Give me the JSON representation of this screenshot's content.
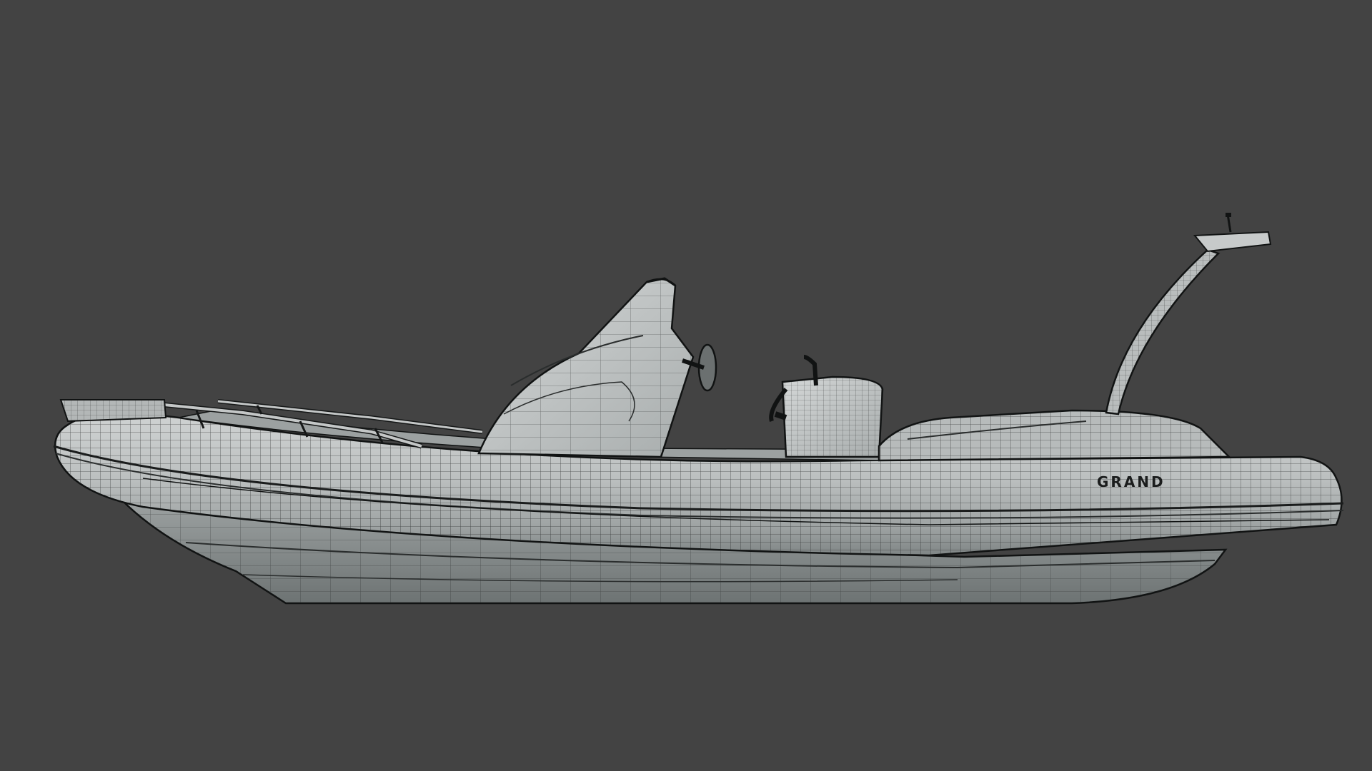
{
  "viewport": {
    "background": "#434343",
    "render_style": "wireframe-shaded"
  },
  "model": {
    "subject": "rigid-inflatable-boat",
    "brand_label": "GRAND",
    "colors": {
      "hull_light": "#c9cccc",
      "hull_mid": "#a9adad",
      "hull_dark": "#7d8282",
      "wire": "#1e2020",
      "outline": "#111313"
    }
  }
}
